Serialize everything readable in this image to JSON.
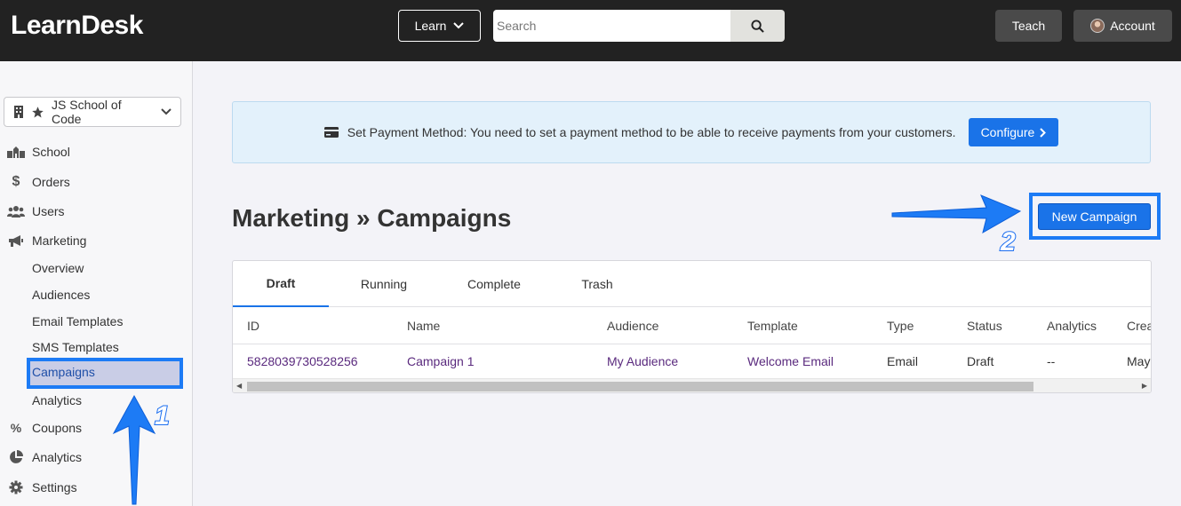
{
  "topbar": {
    "logo": "LearnDesk",
    "learn_label": "Learn",
    "search_placeholder": "Search",
    "teach_label": "Teach",
    "account_label": "Account"
  },
  "sidebar": {
    "school_name": "JS School of Code",
    "items": [
      {
        "label": "School",
        "icon": "school-icon"
      },
      {
        "label": "Orders",
        "icon": "dollar-icon"
      },
      {
        "label": "Users",
        "icon": "users-icon"
      },
      {
        "label": "Marketing",
        "icon": "megaphone-icon"
      }
    ],
    "marketing_sub": [
      "Overview",
      "Audiences",
      "Email Templates",
      "SMS Templates",
      "Campaigns",
      "Analytics"
    ],
    "items_after": [
      {
        "label": "Coupons",
        "icon": "percent-icon"
      },
      {
        "label": "Analytics",
        "icon": "pie-chart-icon"
      },
      {
        "label": "Settings",
        "icon": "gear-icon"
      }
    ]
  },
  "notice": {
    "text": "Set Payment Method: You need to set a payment method to be able to receive payments from your customers.",
    "configure_label": "Configure"
  },
  "page": {
    "title": "Marketing » Campaigns",
    "new_campaign_label": "New Campaign"
  },
  "tabs": [
    "Draft",
    "Running",
    "Complete",
    "Trash"
  ],
  "table": {
    "columns": [
      "ID",
      "Name",
      "Audience",
      "Template",
      "Type",
      "Status",
      "Analytics",
      "Crea"
    ],
    "rows": [
      [
        "5828039730528256",
        "Campaign 1",
        "My Audience",
        "Welcome Email",
        "Email",
        "Draft",
        "--",
        "May"
      ]
    ]
  },
  "annotations": {
    "step1": "1",
    "step2": "2",
    "accent_color": "#1d7bf5"
  }
}
